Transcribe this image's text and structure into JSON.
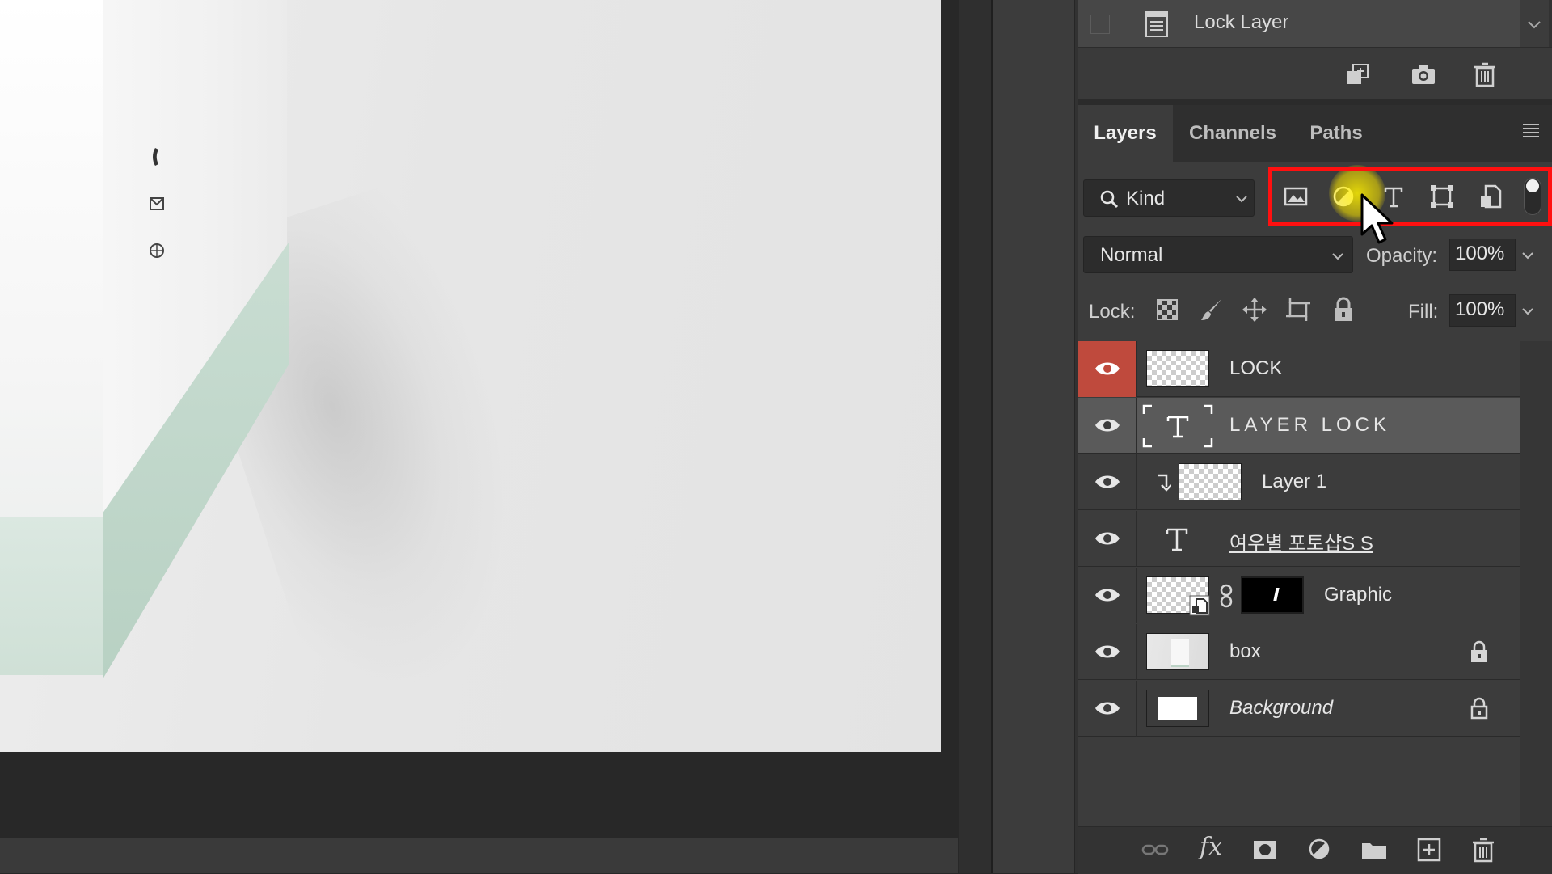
{
  "history": {
    "item_label": "Lock Layer",
    "icons": [
      "new-document-from-state-icon",
      "camera-icon",
      "trash-icon"
    ]
  },
  "tabs": [
    {
      "label": "Layers",
      "active": true
    },
    {
      "label": "Channels",
      "active": false
    },
    {
      "label": "Paths",
      "active": false
    }
  ],
  "filter": {
    "kind_label": "Kind",
    "icons": [
      "pixel-filter-icon",
      "adjustment-filter-icon",
      "type-filter-icon",
      "shape-filter-icon",
      "smart-object-filter-icon"
    ]
  },
  "blend": {
    "mode": "Normal",
    "opacity_label": "Opacity:",
    "opacity_value": "100%",
    "fill_label": "Fill:",
    "fill_value": "100%"
  },
  "lock": {
    "label": "Lock:",
    "icons": [
      "lock-transparent-pixels-icon",
      "lock-image-pixels-icon",
      "lock-position-icon",
      "lock-artboard-icon",
      "lock-all-icon"
    ]
  },
  "layers": [
    {
      "name": "LOCK",
      "kind": "pixel",
      "selected": false,
      "eye_highlight": true
    },
    {
      "name": "LAYER LOCK",
      "kind": "type",
      "selected": true
    },
    {
      "name": "Layer 1",
      "kind": "pixel-clipped",
      "selected": false
    },
    {
      "name": "여우별 포토샵S S",
      "kind": "type",
      "selected": false
    },
    {
      "name": "Graphic",
      "kind": "smart-masked",
      "selected": false
    },
    {
      "name": "box",
      "kind": "pixel",
      "selected": false,
      "locked": true
    },
    {
      "name": "Background",
      "kind": "background",
      "selected": false,
      "locked": true
    }
  ],
  "colors": {
    "highlight_box": "#ff1010",
    "eye_active": "#bf4a3d",
    "cursor_glow": "#f0dc00"
  },
  "bottom_toolbar": {
    "icons": [
      "link-layers-icon",
      "fx-icon",
      "add-mask-icon",
      "adjustment-layer-icon",
      "group-folder-icon",
      "new-layer-icon",
      "delete-layer-icon"
    ],
    "fx_label": "fx"
  }
}
